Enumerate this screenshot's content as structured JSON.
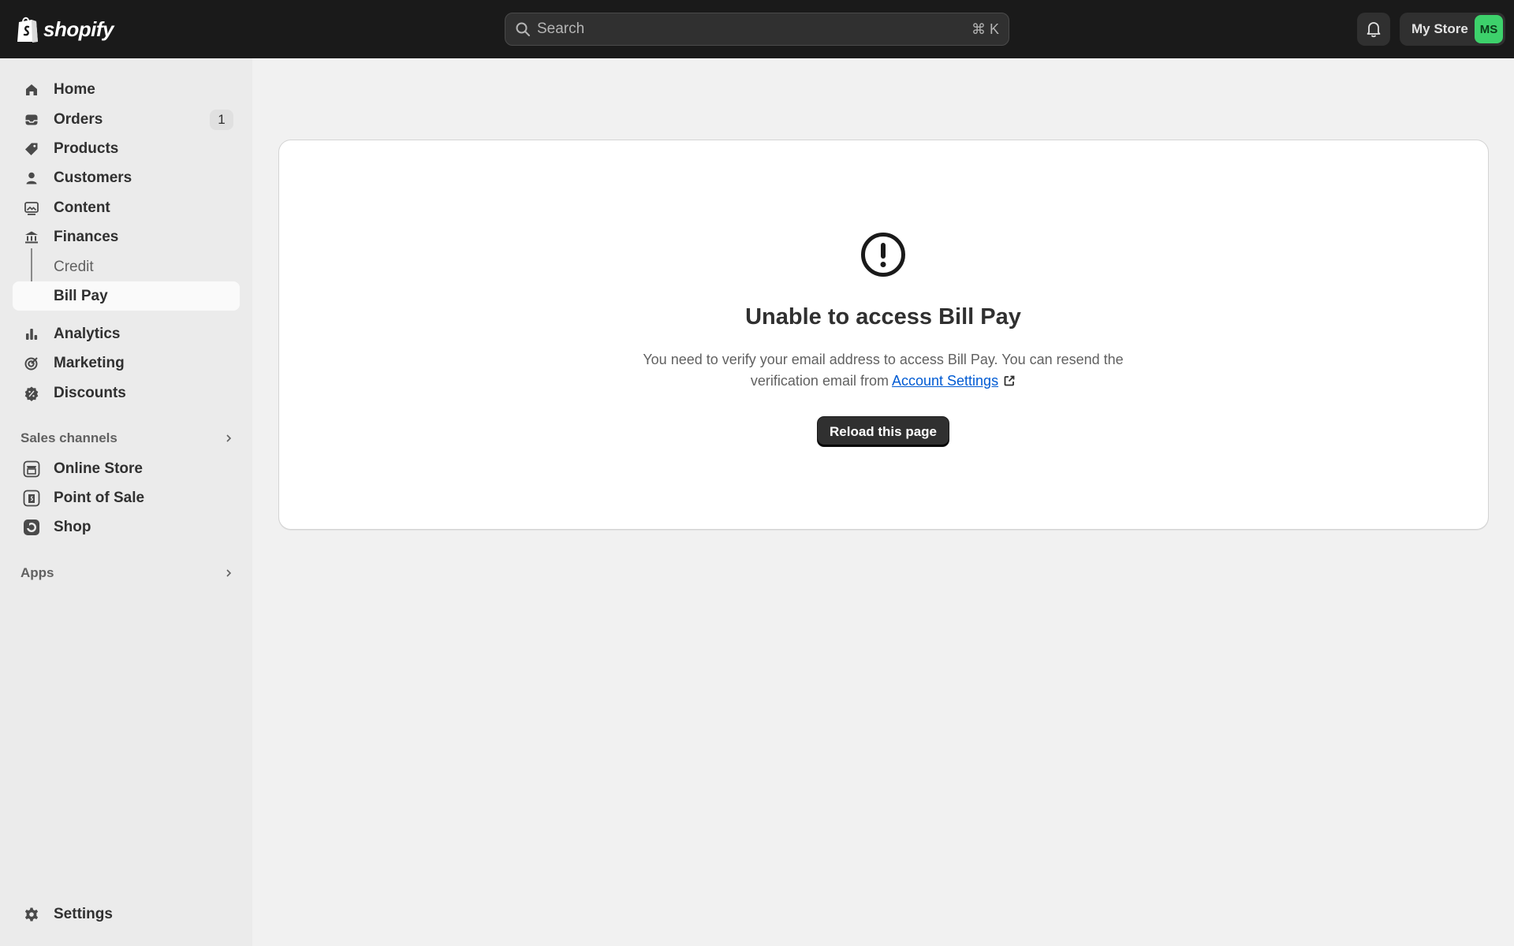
{
  "topbar": {
    "brand": "shopify",
    "search": {
      "placeholder": "Search",
      "shortcut": "⌘ K"
    },
    "store": {
      "name": "My Store",
      "avatar_initials": "MS",
      "avatar_color": "#3dd16b"
    }
  },
  "sidebar": {
    "items": [
      {
        "label": "Home",
        "icon": "home-icon"
      },
      {
        "label": "Orders",
        "icon": "inbox-icon",
        "badge": "1"
      },
      {
        "label": "Products",
        "icon": "tag-icon"
      },
      {
        "label": "Customers",
        "icon": "person-icon"
      },
      {
        "label": "Content",
        "icon": "image-icon"
      },
      {
        "label": "Finances",
        "icon": "bank-icon"
      },
      {
        "label": "Credit",
        "sub": true
      },
      {
        "label": "Bill Pay",
        "sub": true,
        "active": true
      },
      {
        "label": "Analytics",
        "icon": "bar-chart-icon"
      },
      {
        "label": "Marketing",
        "icon": "target-icon"
      },
      {
        "label": "Discounts",
        "icon": "discount-icon"
      }
    ],
    "sales_channels": {
      "heading": "Sales channels",
      "items": [
        {
          "label": "Online Store",
          "icon": "online-store-icon"
        },
        {
          "label": "Point of Sale",
          "icon": "pos-icon"
        },
        {
          "label": "Shop",
          "icon": "shop-icon"
        }
      ]
    },
    "apps": {
      "heading": "Apps"
    },
    "settings": {
      "label": "Settings",
      "icon": "gear-icon"
    }
  },
  "main": {
    "title": "Unable to access Bill Pay",
    "body_text": "You need to verify your email address to access Bill Pay. You can resend the verification email from",
    "link_text": "Account Settings",
    "button_label": "Reload this page"
  },
  "colors": {
    "topbar": "#1a1a1a",
    "link": "#005bd3",
    "primary_button": "#303030"
  }
}
